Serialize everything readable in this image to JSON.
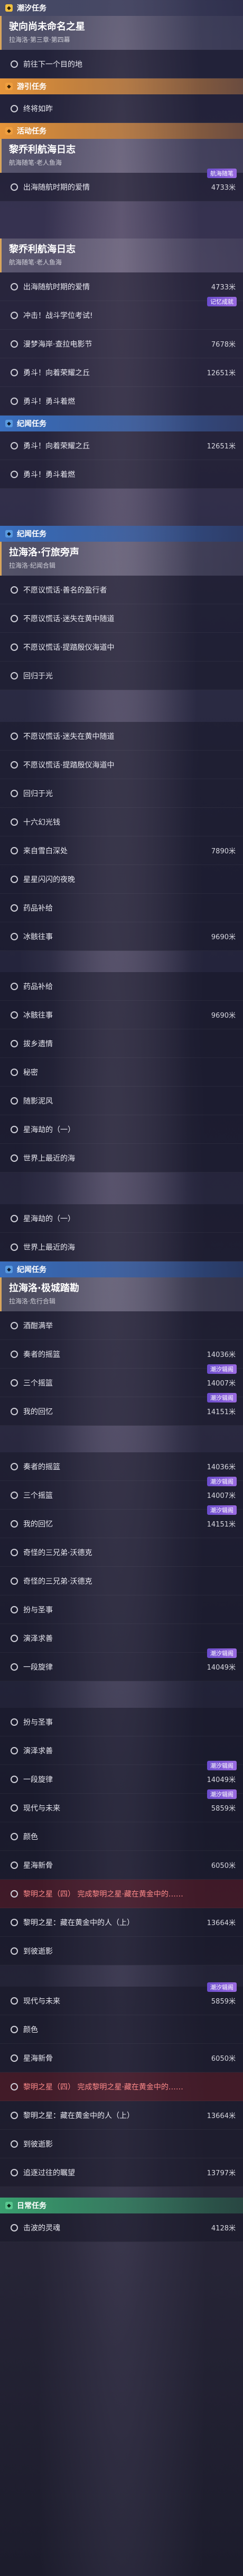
{
  "sections": [
    {
      "type": "header",
      "color": "y",
      "label": "潮汐任务"
    }
  ],
  "sel1": {
    "title": "驶向尚未命名之星",
    "sub": "拉海洛·第三章·第四幕"
  },
  "row_first": "前往下一个目的地",
  "h_sub1": "游引任务",
  "row_sub1": "终将如昨",
  "h_huo": "活动任务",
  "sel2": {
    "title": "黎乔利航海日志",
    "sub": "航海随笔·老人鱼海"
  },
  "huo_rows": [
    {
      "label": "出海随航时期的爱情",
      "dist": "4733米",
      "badge": "航海随笔"
    },
    {
      "label": "出海随航时期的爱情",
      "dist": "4733米",
      "badge": "航海随笔"
    }
  ],
  "sel3": {
    "title": "黎乔利航海日志",
    "sub": "航海随笔·老人鱼海"
  },
  "huo_rows2": [
    {
      "label": "出海随航时期的爱情",
      "dist": "4733米"
    },
    {
      "label": "冲击！战斗学位考试!",
      "dist": "",
      "badge": "记忆成就"
    },
    {
      "label": "漫梦海岸·查拉电影节",
      "dist": "7678米"
    },
    {
      "label": "勇斗！向着荣耀之丘",
      "dist": "12651米"
    },
    {
      "label": "勇斗！勇斗着燃",
      "dist": ""
    }
  ],
  "h_ji": "纪闻任务",
  "ji_rows": [
    {
      "label": "勇斗！向着荣耀之丘",
      "dist": "12651米"
    },
    {
      "label": "勇斗！勇斗着燃",
      "dist": ""
    }
  ],
  "h_ji2": "纪闻任务",
  "sel4": {
    "title": "拉海洛·行旅旁声",
    "sub": "拉海洛·纪闻合辑"
  },
  "ji2_rows": [
    {
      "label": "不愿议慌话·善名的盈行者"
    },
    {
      "label": "不愿议慌话·迷失在黄中随道"
    },
    {
      "label": "不愿议慌话·提踏殷仪海道中"
    },
    {
      "label": "回归于光"
    }
  ],
  "repeat_rows": [
    {
      "label": "不愿议慌话·迷失在黄中随道",
      "dist": ""
    },
    {
      "label": "不愿议慌话·提踏殷仪海道中",
      "dist": ""
    },
    {
      "label": "回归于光",
      "dist": ""
    },
    {
      "label": "十六幻光钱",
      "dist": ""
    },
    {
      "label": "来自雪白深处",
      "dist": "7890米"
    },
    {
      "label": "星星闪闪的夜晚",
      "dist": ""
    },
    {
      "label": "药品补给",
      "dist": ""
    },
    {
      "label": "冰骸往事",
      "dist": "9690米"
    }
  ],
  "repeat_rows2": [
    {
      "label": "药品补给",
      "dist": ""
    },
    {
      "label": "冰骸往事",
      "dist": "9690米"
    },
    {
      "label": "拔乡遗情",
      "dist": ""
    },
    {
      "label": "秘密",
      "dist": ""
    },
    {
      "label": "随影泥风",
      "dist": ""
    },
    {
      "label": "星海劫的（一）",
      "dist": ""
    },
    {
      "label": "世界上最近的海",
      "dist": ""
    }
  ],
  "repeat_rows3": [
    {
      "label": "星海劫的（一）"
    },
    {
      "label": "世界上最近的海"
    }
  ],
  "h_ji3": "纪闻任务",
  "sel5": {
    "title": "拉海洛·极城踏勘",
    "sub": "拉海洛·危行合辑"
  },
  "ji3_rows": [
    {
      "label": "酒酣满举",
      "dist": ""
    },
    {
      "label": "奏者的摇篮",
      "dist": "14036米"
    },
    {
      "label": "三个摇篮",
      "dist": "14007米",
      "badge": "潮汐辑阁"
    },
    {
      "label": "我的回忆",
      "dist": "14151米",
      "badge": "潮汐辑阁"
    }
  ],
  "repeat_rows4": [
    {
      "label": "奏者的摇篮",
      "dist": "14036米"
    },
    {
      "label": "三个摇篮",
      "dist": "14007米",
      "badge": "潮汐辑阁"
    },
    {
      "label": "我的回忆",
      "dist": "14151米",
      "badge": "潮汐辑阁"
    },
    {
      "label": "奇怪的三兄弟·沃德克",
      "dist": ""
    },
    {
      "label": "奇怪的三兄弟·沃德克",
      "dist": ""
    },
    {
      "label": "扮与圣事",
      "dist": ""
    },
    {
      "label": "演泽求善",
      "dist": ""
    },
    {
      "label": "一段旋律",
      "dist": "14049米",
      "badge": "潮汐辑阁"
    }
  ],
  "repeat_rows5": [
    {
      "label": "扮与圣事",
      "dist": ""
    },
    {
      "label": "演泽求善",
      "dist": ""
    },
    {
      "label": "一段旋律",
      "dist": "14049米",
      "badge": "潮汐辑阁"
    },
    {
      "label": "现代与未来",
      "dist": "5859米",
      "badge": "潮汐辑阁"
    },
    {
      "label": "颜色",
      "dist": ""
    },
    {
      "label": "星海新骨",
      "dist": "6050米"
    },
    {
      "label": "黎明之星（四）",
      "dist": "",
      "red": "完成黎明之星·藏在黄金中的……"
    },
    {
      "label": "黎明之星：藏在黄金中的人（上）",
      "dist": "13664米"
    },
    {
      "label": "到彼逝影",
      "dist": ""
    }
  ],
  "repeat_rows6": [
    {
      "label": "现代与未来",
      "dist": "5859米",
      "badge": "潮汐辑阁"
    },
    {
      "label": "颜色",
      "dist": ""
    },
    {
      "label": "星海新骨",
      "dist": "6050米"
    },
    {
      "label": "黎明之星（四）",
      "dist": "",
      "red": "完成黎明之星·藏在黄金中的……"
    },
    {
      "label": "黎明之星：藏在黄金中的人（上）",
      "dist": "13664米"
    },
    {
      "label": "到彼逝影",
      "dist": ""
    },
    {
      "label": "追逐过往的瞩望",
      "dist": "13797米"
    }
  ],
  "h_ri": "日常任务",
  "row_last": {
    "label": "击波的灵魂",
    "dist": "4128米"
  }
}
